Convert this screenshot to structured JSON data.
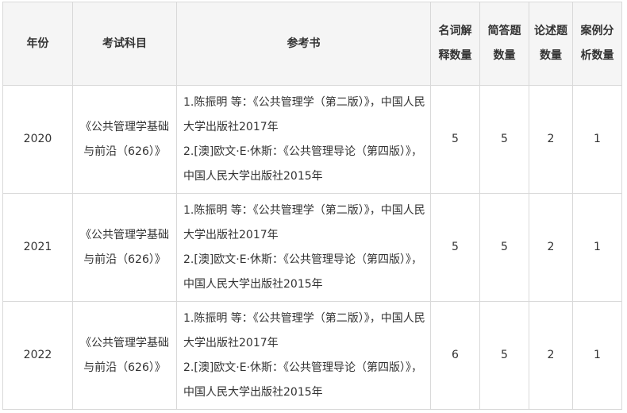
{
  "table": {
    "headers": {
      "year": "年份",
      "subject": "考试科目",
      "books": "参考书",
      "terms": "名词解释数量",
      "short": "简答题数量",
      "essay": "论述题数量",
      "case": "案例分析数量"
    },
    "rows": [
      {
        "year": "2020",
        "subject": "《公共管理学基础与前沿（626）》",
        "book1": "1.陈振明 等：《公共管理学（第二版）》，中国人民大学出版社2017年",
        "book2": "2.[澳]欧文·E·休斯：《公共管理导论（第四版）》，中国人民大学出版社2015年",
        "terms": "5",
        "short": "5",
        "essay": "2",
        "case": "1"
      },
      {
        "year": "2021",
        "subject": "《公共管理学基础与前沿（626）》",
        "book1": "1.陈振明 等：《公共管理学（第二版）》，中国人民大学出版社2017年",
        "book2": "2.[澳]欧文·E·休斯：《公共管理导论（第四版）》，中国人民大学出版社2015年",
        "terms": "5",
        "short": "5",
        "essay": "2",
        "case": "1"
      },
      {
        "year": "2022",
        "subject": "《公共管理学基础与前沿（626）》",
        "book1": "1.陈振明 等：《公共管理学（第二版）》，中国人民大学出版社2017年",
        "book2": "2.[澳]欧文·E·休斯：《公共管理导论（第四版）》，中国人民大学出版社2015年",
        "terms": "6",
        "short": "5",
        "essay": "2",
        "case": "1"
      }
    ]
  }
}
